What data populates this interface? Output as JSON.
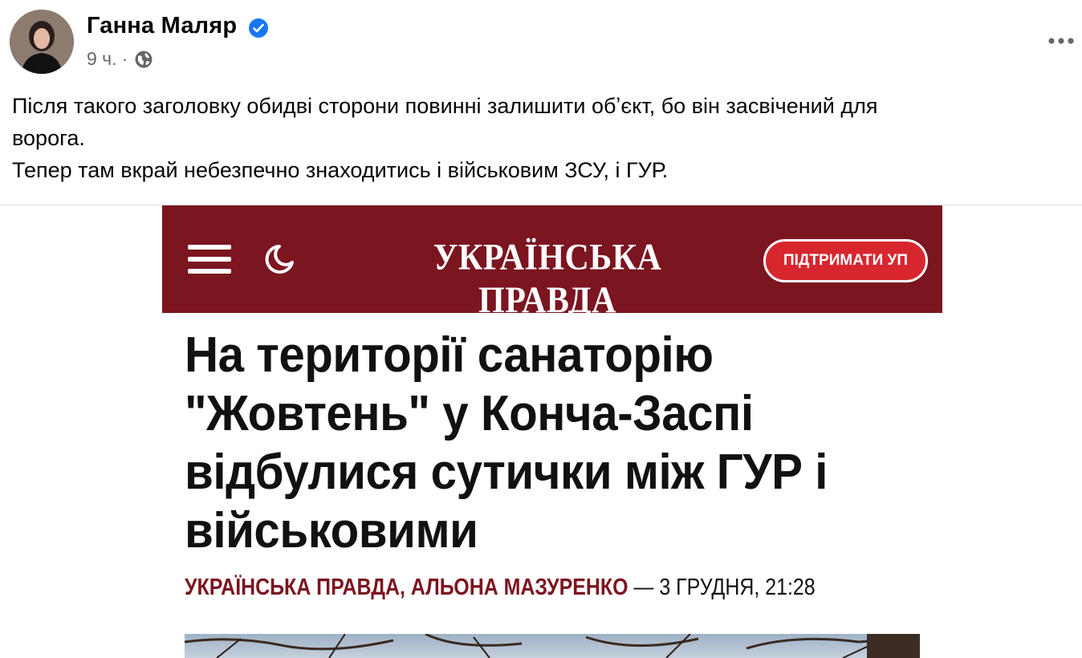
{
  "post": {
    "author_name": "Ганна Маляр",
    "timestamp": "9 ч.",
    "separator": "·",
    "text_lines": [
      "Після такого заголовку обидві сторони повинні залишити обʼєкт, бо він засвічений для",
      "ворога.",
      "Тепер там вкрай небезпечно знаходитись і військовим ЗСУ, і ГУР."
    ],
    "icons": [
      "verified-badge-icon",
      "globe-icon",
      "more-options-icon"
    ],
    "colors": {
      "verified": "#1877f2",
      "meta_text": "#65676b"
    }
  },
  "shared_image": {
    "site_logo": "УКРАЇНСЬКА ПРАВДА",
    "support_button": "ПІДТРИМАТИ УП",
    "header_icons": [
      "hamburger-menu-icon",
      "moon-icon"
    ],
    "article_title": "На території санаторію \"Жовтень\" у Конча-Заспі відбулися сутички між ГУР і військовими",
    "byline_source": "УКРАЇНСЬКА ПРАВДА, АЛЬОНА МАЗУРЕНКО",
    "byline_rest": " — 3 ГРУДНЯ, 21:28",
    "colors": {
      "header_bg": "#7b1520",
      "button_bg": "#d8262e",
      "accent": "#7b1520"
    }
  }
}
